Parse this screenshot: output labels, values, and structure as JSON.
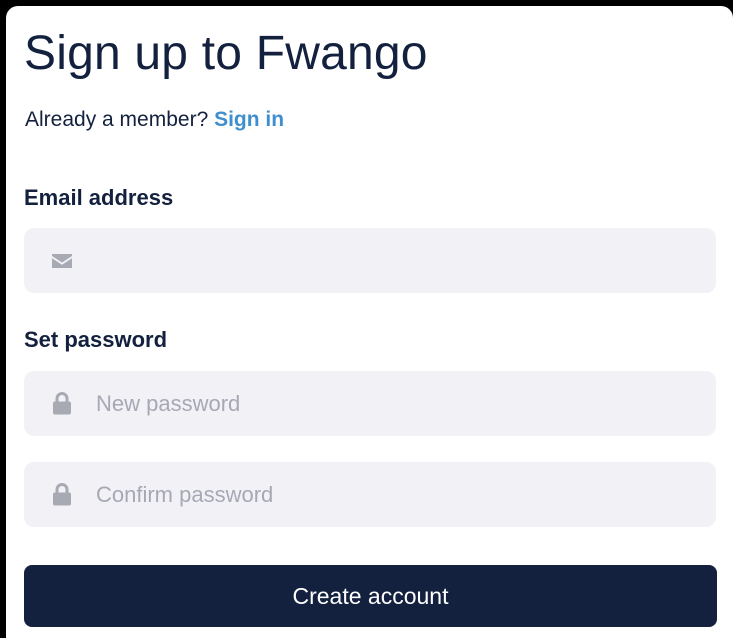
{
  "form": {
    "title": "Sign up to Fwango",
    "already_member_text": "Already a member? ",
    "sign_in_link": "Sign in",
    "email": {
      "label": "Email address",
      "value": "",
      "placeholder": "",
      "icon": "envelope-icon"
    },
    "password": {
      "label": "Set password",
      "new": {
        "value": "",
        "placeholder": "New password",
        "icon": "lock-icon"
      },
      "confirm": {
        "value": "",
        "placeholder": "Confirm password",
        "icon": "lock-icon"
      }
    },
    "submit_label": "Create account"
  },
  "colors": {
    "primary": "#13213e",
    "link": "#3f8fce",
    "field_background": "#f2f2f6",
    "placeholder": "#a6a8b4",
    "icon": "#a7a9b3"
  }
}
